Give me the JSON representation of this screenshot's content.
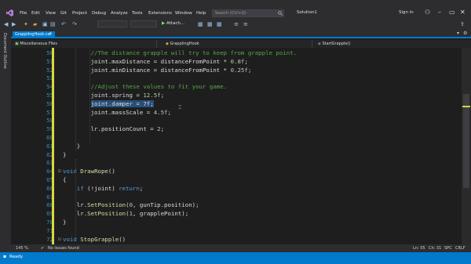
{
  "menu": {
    "items": [
      "File",
      "Edit",
      "View",
      "Git",
      "Project",
      "Debug",
      "Analyze",
      "Tools",
      "Extensions",
      "Window",
      "Help"
    ],
    "search_placeholder": "Search (Ctrl+Q)",
    "solution": "Solution1",
    "signin": "Sign in"
  },
  "toolbar": {
    "attach_label": "Attach..."
  },
  "side_strip": {
    "label": "Document Outline"
  },
  "tabs": {
    "active": "GrapplingHook.cs*",
    "close": "×"
  },
  "navbar": {
    "project": "Miscellaneous Files",
    "class": "GrapplingHook",
    "member": "StartGrapple()"
  },
  "editor": {
    "lines": [
      {
        "n": "50",
        "tokens": [
          [
            "comment",
            "//The distance grapple will try to keep from grapple point."
          ]
        ],
        "indent": 3
      },
      {
        "n": "51",
        "tokens": [
          [
            "plain",
            "joint.maxDistance = distanceFromPoint * "
          ],
          [
            "num",
            "0.8f"
          ],
          [
            "plain",
            ";"
          ]
        ],
        "indent": 3
      },
      {
        "n": "52",
        "tokens": [
          [
            "plain",
            "joint.minDistance = distanceFromPoint * "
          ],
          [
            "num",
            "0.25f"
          ],
          [
            "plain",
            ";"
          ]
        ],
        "indent": 3
      },
      {
        "n": "53",
        "tokens": [],
        "indent": 3
      },
      {
        "n": "54",
        "tokens": [
          [
            "comment",
            "//Adjust these values to fit your game."
          ]
        ],
        "indent": 3
      },
      {
        "n": "55",
        "tokens": [
          [
            "plain",
            "joint.spring = "
          ],
          [
            "num",
            "12.5f"
          ],
          [
            "plain",
            ";"
          ]
        ],
        "indent": 3
      },
      {
        "n": "56",
        "tokens": [
          [
            "sel",
            "joint.damper = 7f;"
          ]
        ],
        "indent": 3
      },
      {
        "n": "57",
        "tokens": [
          [
            "plain",
            "joint.massScale = "
          ],
          [
            "num",
            "4.5f"
          ],
          [
            "plain",
            ";"
          ]
        ],
        "indent": 3
      },
      {
        "n": "58",
        "tokens": [],
        "indent": 3
      },
      {
        "n": "59",
        "tokens": [
          [
            "plain",
            "lr.positionCount = "
          ],
          [
            "num",
            "2"
          ],
          [
            "plain",
            ";"
          ]
        ],
        "indent": 3
      },
      {
        "n": "60",
        "tokens": [],
        "indent": 3
      },
      {
        "n": "61",
        "tokens": [
          [
            "plain",
            "}"
          ]
        ],
        "indent": 2
      },
      {
        "n": "62",
        "tokens": [
          [
            "plain",
            "}"
          ]
        ],
        "indent": 1
      },
      {
        "n": "63",
        "tokens": [],
        "indent": 1
      },
      {
        "n": "64",
        "tokens": [
          [
            "kw",
            "void"
          ],
          [
            "plain",
            " "
          ],
          [
            "method",
            "DrawRope"
          ],
          [
            "plain",
            "()"
          ]
        ],
        "indent": 1,
        "fold": true
      },
      {
        "n": "65",
        "tokens": [
          [
            "plain",
            "{"
          ]
        ],
        "indent": 1
      },
      {
        "n": "66",
        "tokens": [
          [
            "kw",
            "if"
          ],
          [
            "plain",
            " (!joint) "
          ],
          [
            "kw",
            "return"
          ],
          [
            "plain",
            ";"
          ]
        ],
        "indent": 2
      },
      {
        "n": "67",
        "tokens": [],
        "indent": 2
      },
      {
        "n": "68",
        "tokens": [
          [
            "plain",
            "lr."
          ],
          [
            "method",
            "SetPosition"
          ],
          [
            "plain",
            "("
          ],
          [
            "num",
            "0"
          ],
          [
            "plain",
            ", gunTip.position);"
          ]
        ],
        "indent": 2
      },
      {
        "n": "69",
        "tokens": [
          [
            "plain",
            "lr."
          ],
          [
            "method",
            "SetPosition"
          ],
          [
            "plain",
            "("
          ],
          [
            "num",
            "1"
          ],
          [
            "plain",
            ", grapplePoint);"
          ]
        ],
        "indent": 2
      },
      {
        "n": "70",
        "tokens": [
          [
            "plain",
            "}"
          ]
        ],
        "indent": 1
      },
      {
        "n": "71",
        "tokens": [],
        "indent": 1
      },
      {
        "n": "72",
        "tokens": [
          [
            "kw",
            "void"
          ],
          [
            "plain",
            " "
          ],
          [
            "method",
            "StopGrapple"
          ],
          [
            "plain",
            "()"
          ]
        ],
        "indent": 1,
        "fold": true
      }
    ]
  },
  "infobar": {
    "zoom": "145 %",
    "issues": "No issues found",
    "line": "Ln: 55",
    "char": "Ch: 31",
    "spc": "SPC",
    "crlf": "CRLF"
  },
  "statusbar": {
    "text": "Ready"
  },
  "colors": {
    "accent": "#007acc",
    "changebar": "#d7d742"
  }
}
